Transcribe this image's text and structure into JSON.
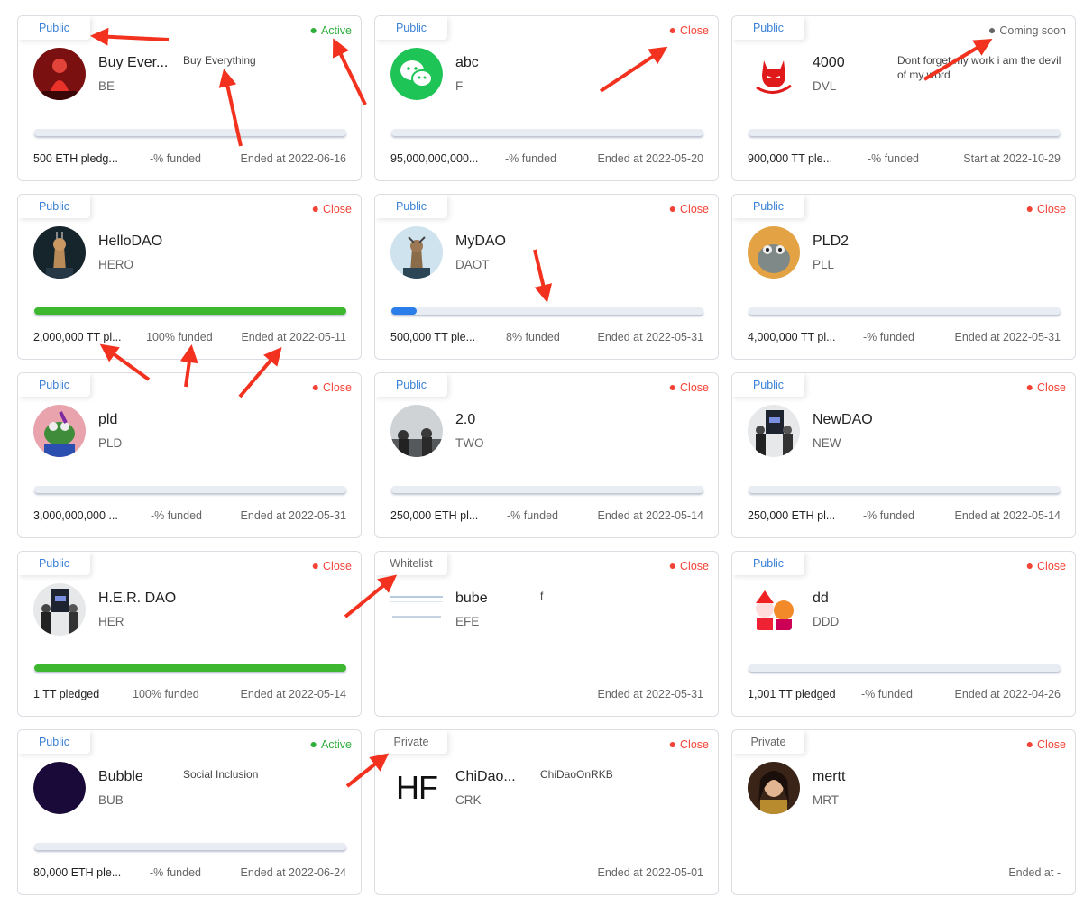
{
  "cards": [
    {
      "visibility": "Public",
      "status": "Active",
      "status_color": "green",
      "name": "Buy Ever...",
      "symbol": "BE",
      "description": "Buy Everything",
      "progress": 0,
      "pledged": "500 ETH pledg...",
      "funded": "-% funded",
      "date": "Ended at 2022-06-16",
      "avatar": "red-figure"
    },
    {
      "visibility": "Public",
      "status": "Close",
      "status_color": "red",
      "name": "abc",
      "symbol": "F",
      "description": "",
      "progress": 0,
      "pledged": "95,000,000,000...",
      "funded": "-% funded",
      "date": "Ended at 2022-05-20",
      "avatar": "wechat-logo"
    },
    {
      "visibility": "Public",
      "status": "Coming soon",
      "status_color": "gray",
      "name": "4000",
      "symbol": "DVL",
      "description": "Dont forget my work i am the devil of my word",
      "progress": 0,
      "pledged": "900,000 TT ple...",
      "funded": "-% funded",
      "date": "Start at 2022-10-29",
      "avatar": "devil-logo"
    },
    {
      "visibility": "Public",
      "status": "Close",
      "status_color": "red",
      "name": "HelloDAO",
      "symbol": "HERO",
      "description": "",
      "progress": 100,
      "pledged": "2,000,000 TT pl...",
      "funded": "100% funded",
      "date": "Ended at 2022-05-11",
      "avatar": "giraffe-dark"
    },
    {
      "visibility": "Public",
      "status": "Close",
      "status_color": "red",
      "name": "MyDAO",
      "symbol": "DAOT",
      "description": "",
      "progress": 8,
      "pledged": "500,000 TT ple...",
      "funded": "8% funded",
      "date": "Ended at 2022-05-31",
      "avatar": "giraffe-light"
    },
    {
      "visibility": "Public",
      "status": "Close",
      "status_color": "red",
      "name": "PLD2",
      "symbol": "PLL",
      "description": "",
      "progress": 0,
      "pledged": "4,000,000 TT pl...",
      "funded": "-% funded",
      "date": "Ended at 2022-05-31",
      "avatar": "frog-orange"
    },
    {
      "visibility": "Public",
      "status": "Close",
      "status_color": "red",
      "name": "pld",
      "symbol": "PLD",
      "description": "",
      "progress": 0,
      "pledged": "3,000,000,000 ...",
      "funded": "-% funded",
      "date": "Ended at 2022-05-31",
      "avatar": "frog-pink"
    },
    {
      "visibility": "Public",
      "status": "Close",
      "status_color": "red",
      "name": "2.0",
      "symbol": "TWO",
      "description": "",
      "progress": 0,
      "pledged": "250,000 ETH pl...",
      "funded": "-% funded",
      "date": "Ended at 2022-05-14",
      "avatar": "photo-people"
    },
    {
      "visibility": "Public",
      "status": "Close",
      "status_color": "red",
      "name": "NewDAO",
      "symbol": "NEW",
      "description": "",
      "progress": 0,
      "pledged": "250,000 ETH pl...",
      "funded": "-% funded",
      "date": "Ended at 2022-05-14",
      "avatar": "photo-screen"
    },
    {
      "visibility": "Public",
      "status": "Close",
      "status_color": "red",
      "name": "H.E.R. DAO",
      "symbol": "HER",
      "description": "",
      "progress": 100,
      "pledged": "1 TT pledged",
      "funded": "100% funded",
      "date": "Ended at 2022-05-14",
      "avatar": "photo-screen"
    },
    {
      "visibility": "Whitelist",
      "status": "Close",
      "status_color": "red",
      "name": "bube",
      "symbol": "EFE",
      "description": "f",
      "progress": null,
      "pledged": "",
      "funded": "",
      "date": "Ended at 2022-05-31",
      "avatar": "screenshot-thumb"
    },
    {
      "visibility": "Public",
      "status": "Close",
      "status_color": "red",
      "name": "dd",
      "symbol": "DDD",
      "description": "",
      "progress": 0,
      "pledged": "1,001 TT pledged",
      "funded": "-% funded",
      "date": "Ended at 2022-04-26",
      "avatar": "cartoon-pair"
    },
    {
      "visibility": "Public",
      "status": "Active",
      "status_color": "green",
      "name": "Bubble",
      "symbol": "BUB",
      "description": "Social Inclusion",
      "progress": 0,
      "pledged": "80,000 ETH ple...",
      "funded": "-% funded",
      "date": "Ended at 2022-06-24",
      "avatar": "dark-circle"
    },
    {
      "visibility": "Private",
      "status": "Close",
      "status_color": "red",
      "name": "ChiDao...",
      "symbol": "CRK",
      "description": "ChiDaoOnRKB",
      "progress": null,
      "pledged": "",
      "funded": "",
      "date": "Ended at 2022-05-01",
      "avatar": "hf-text",
      "avatar_text": "HF"
    },
    {
      "visibility": "Private",
      "status": "Close",
      "status_color": "red",
      "name": "mertt",
      "symbol": "MRT",
      "description": "",
      "progress": null,
      "pledged": "",
      "funded": "",
      "date": "Ended at -",
      "avatar": "portrait"
    }
  ],
  "colors": {
    "blue": "#3b82d6",
    "green": "#2eae3b",
    "red": "#f44336",
    "gray": "#666666",
    "arrow": "#f2311e"
  }
}
